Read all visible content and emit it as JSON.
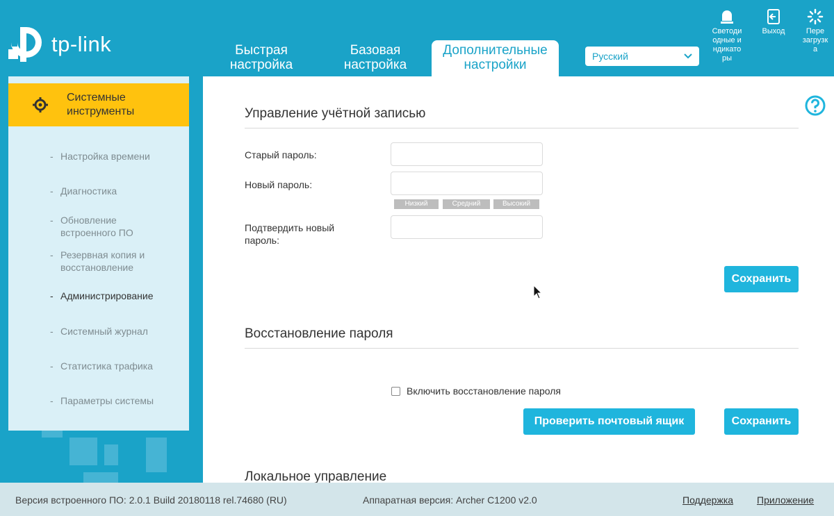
{
  "header": {
    "logo_text": "tp-link",
    "tabs": [
      {
        "line1": "Быстрая",
        "line2": "настройка"
      },
      {
        "line1": "Базовая",
        "line2": "настройка"
      },
      {
        "line1": "Дополнительные",
        "line2": "настройки"
      }
    ],
    "language": "Русский",
    "icons": {
      "leds": "Светоди одные и ндикато ры",
      "logout": "Выход",
      "reboot": "Пере загрузк а"
    }
  },
  "sidebar": {
    "active": {
      "line1": "Системные",
      "line2": "инструменты"
    },
    "items": [
      {
        "line1": "Настройка времени",
        "line2": ""
      },
      {
        "line1": "Диагностика",
        "line2": ""
      },
      {
        "line1": "Обновление",
        "line2": "встроенного ПО"
      },
      {
        "line1": "Резервная копия и",
        "line2": "восстановление"
      },
      {
        "line1": "Администрирование",
        "line2": ""
      },
      {
        "line1": "Системный журнал",
        "line2": ""
      },
      {
        "line1": "Статистика трафика",
        "line2": ""
      },
      {
        "line1": "Параметры системы",
        "line2": ""
      }
    ]
  },
  "account": {
    "title": "Управление учётной записью",
    "old_password_label": "Старый пароль:",
    "new_password_label": "Новый пароль:",
    "confirm_label_1": "Подтвердить новый",
    "confirm_label_2": "пароль:",
    "strength": [
      "Низкий",
      "Средний",
      "Высокий"
    ],
    "save": "Сохранить"
  },
  "recovery": {
    "title": "Восстановление пароля",
    "enable_label": "Включить восстановление пароля",
    "enabled": false,
    "check_mailbox": "Проверить почтовый ящик",
    "save": "Сохранить"
  },
  "local": {
    "title": "Локальное управление"
  },
  "footer": {
    "firmware": "Версия встроенного ПО: 2.0.1 Build 20180118 rel.74680 (RU)",
    "hardware": "Аппаратная версия: Archer C1200 v2.0",
    "support": "Поддержка",
    "app": "Приложение"
  },
  "colors": {
    "brand": "#1aa3c8",
    "active_menu": "#ffc20e",
    "button": "#1fb5dd"
  }
}
